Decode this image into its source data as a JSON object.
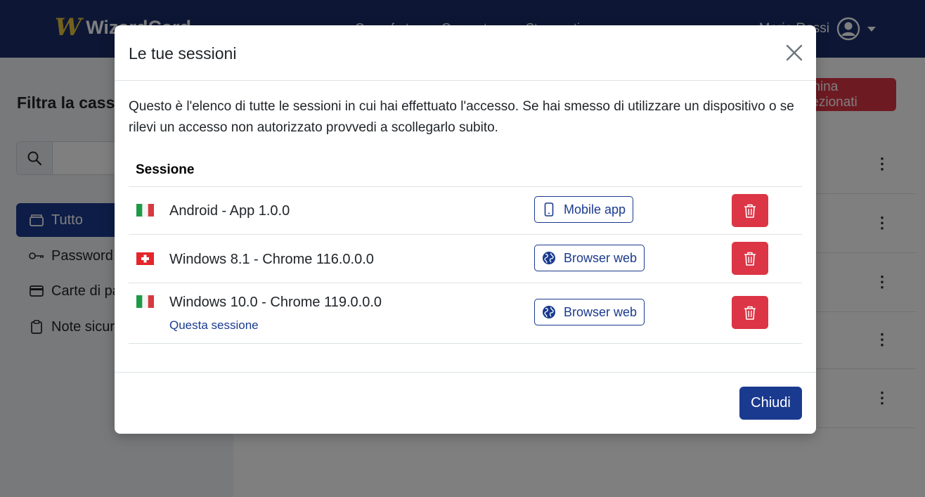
{
  "app": {
    "logo_mark": "W",
    "logo_text": "WizardCard",
    "nav_items": [
      "Cassaforte",
      "Generatore",
      "Strumenti"
    ],
    "user_name": "Mario Rossi",
    "account_icon": "user-circle-icon"
  },
  "sidebar": {
    "filter_title": "Filtra la cassaforte",
    "search_placeholder": "",
    "items": [
      {
        "label": "Tutto",
        "icon": "wallet-icon",
        "active": true
      },
      {
        "label": "Password",
        "icon": "key-icon",
        "active": false
      },
      {
        "label": "Carte di pagamento",
        "icon": "credit-card-icon",
        "active": false
      },
      {
        "label": "Note sicure",
        "icon": "clipboard-icon",
        "active": false
      }
    ]
  },
  "main": {
    "delete_selected_label": "Elimina selezionati"
  },
  "modal": {
    "title": "Le tue sessioni",
    "intro": "Questo è l'elenco di tutte le sessioni in cui hai effettuato l'accesso. Se hai smesso di utilizzare un dispositivo o se rilevi un accesso non autorizzato provvedi a scollegarlo subito.",
    "column_header": "Sessione",
    "sessions": [
      {
        "flag": "italy",
        "device": "Android - App 1.0.0",
        "type_label": "Mobile app",
        "type_icon": "phone-icon",
        "note": ""
      },
      {
        "flag": "switzerland",
        "device": "Windows 8.1 - Chrome 116.0.0.0",
        "type_label": "Browser web",
        "type_icon": "globe-icon",
        "note": ""
      },
      {
        "flag": "italy",
        "device": "Windows 10.0 - Chrome 119.0.0.0",
        "type_label": "Browser web",
        "type_icon": "globe-icon",
        "note": "Questa sessione"
      }
    ],
    "close_label": "Chiudi"
  },
  "colors": {
    "navbar": "#1a2f6b",
    "primary": "#1a3a8f",
    "danger": "#dc3545",
    "logo_gold": "#e8c33a"
  }
}
